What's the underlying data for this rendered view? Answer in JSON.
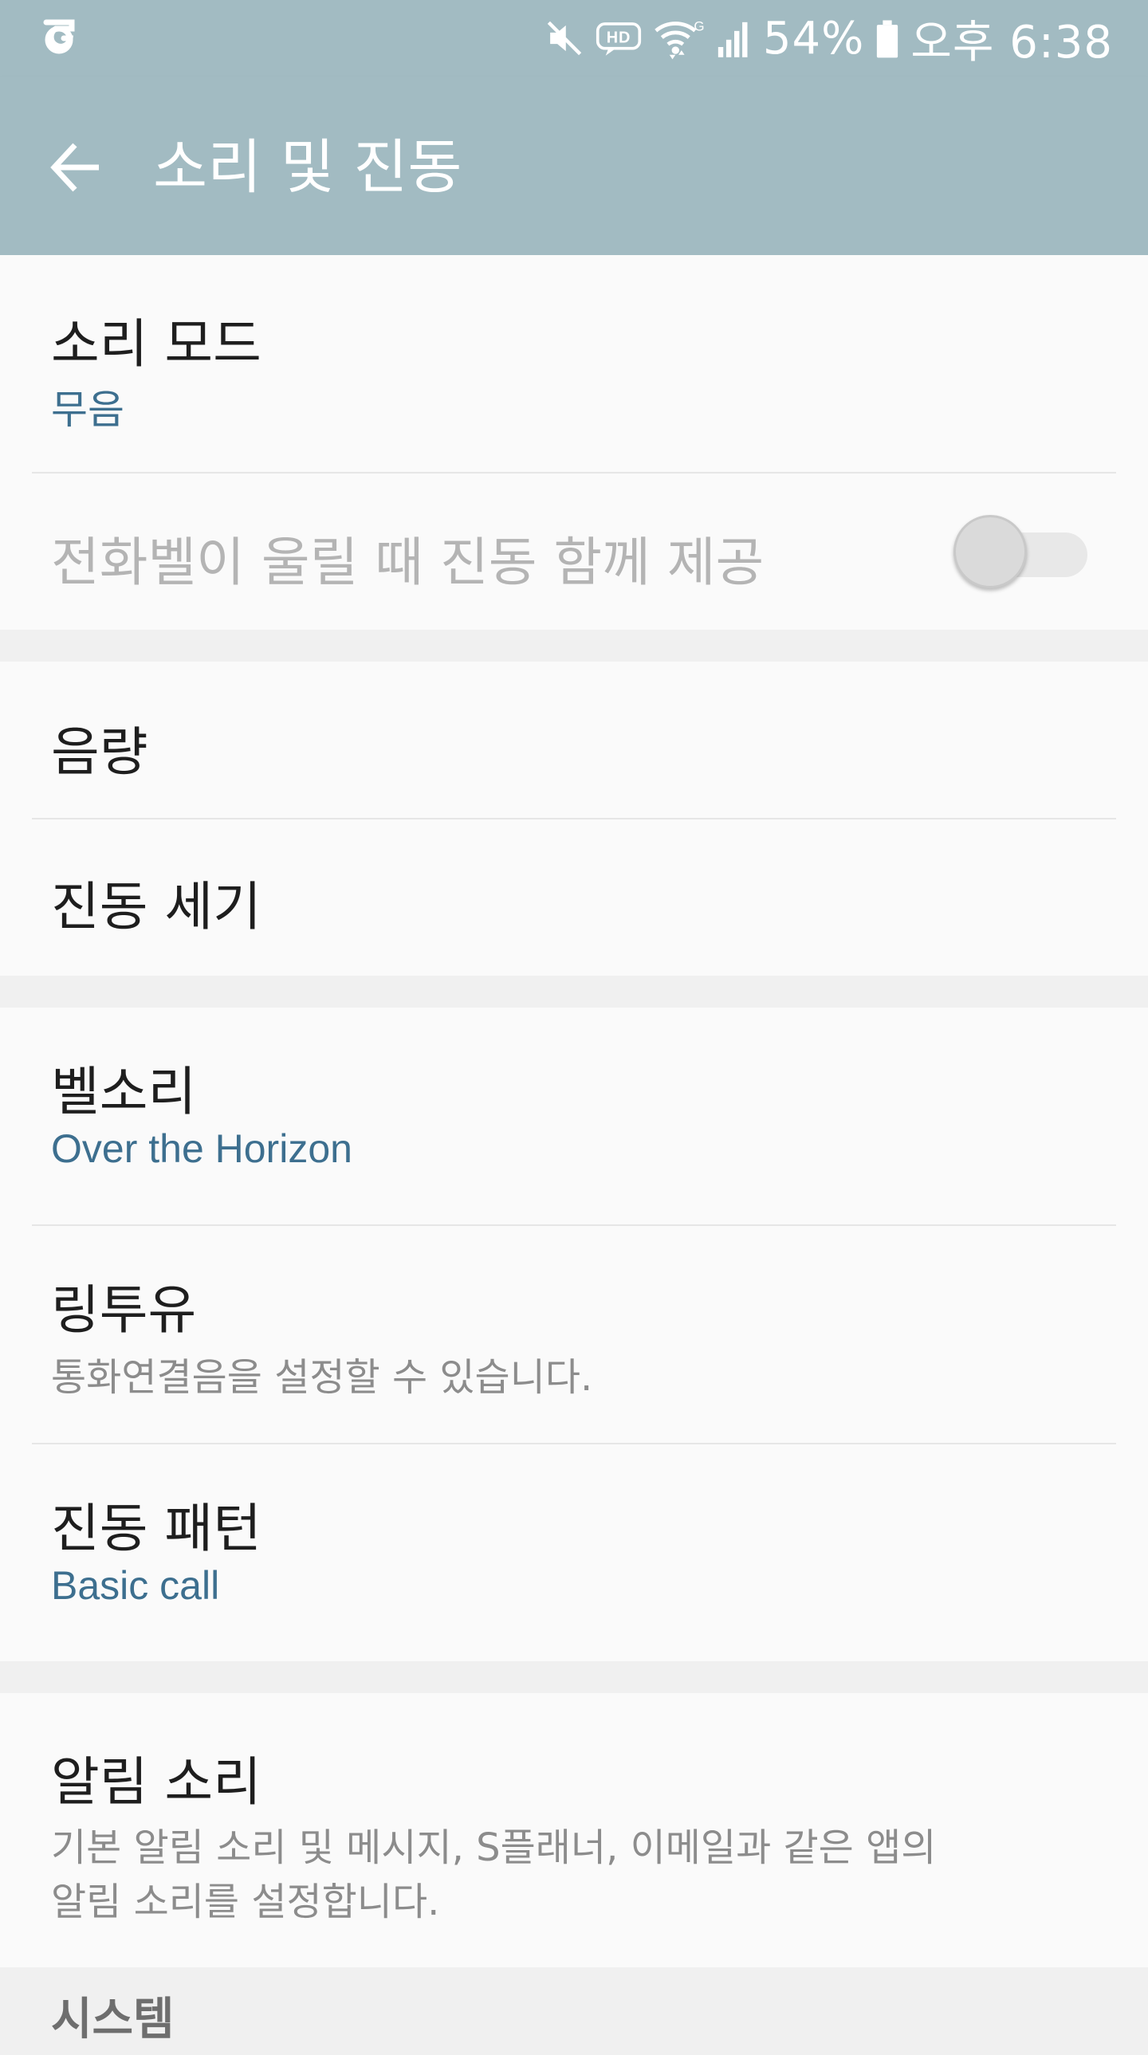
{
  "status_bar": {
    "battery": "54%",
    "time": "오후 6:38",
    "icons": [
      "carrier-icon",
      "mute-icon",
      "hd-voice-icon",
      "wifi-icon",
      "signal-icon",
      "battery-icon"
    ],
    "hd_label": "HD",
    "wifi_label": "G"
  },
  "app_bar": {
    "title": "소리 및 진동",
    "back_icon": "arrow-left-icon"
  },
  "settings": {
    "sound_mode": {
      "title": "소리 모드",
      "value": "무음"
    },
    "vibrate_ring": {
      "title": "전화벨이 울릴 때 진동 함께 제공",
      "checked": false
    },
    "volume": {
      "title": "음량"
    },
    "vibration_intensity": {
      "title": "진동 세기"
    },
    "ringtone": {
      "title": "벨소리",
      "value": "Over the Horizon"
    },
    "ringtu": {
      "title": "링투유",
      "summary": "통화연결음을 설정할 수 있습니다."
    },
    "vibration_pattern": {
      "title": "진동 패턴",
      "value": "Basic call"
    },
    "notification_sound": {
      "title": "알림 소리",
      "summary_line1": "기본 알림 소리 및 메시지, S플래너, 이메일과 같은 앱의",
      "summary_line2": "알림 소리를 설정합니다."
    },
    "system_header": "시스템"
  },
  "colors": {
    "bar": "#a2bbc2",
    "accent_text": "#3d6f8f",
    "background": "#f0f0f0",
    "card": "#fafafa"
  }
}
